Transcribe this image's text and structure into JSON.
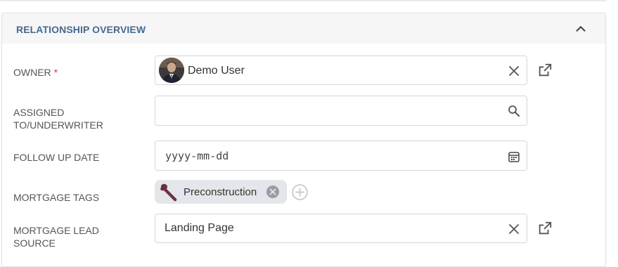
{
  "panel": {
    "title": "RELATIONSHIP OVERVIEW",
    "collapse_icon": "chevron-up-icon"
  },
  "fields": {
    "owner": {
      "label": "OWNER",
      "required_mark": "*",
      "value": "Demo User",
      "clear_icon": "close-icon",
      "link_icon": "open-in-new-icon"
    },
    "assigned_to": {
      "label_line1": "ASSIGNED",
      "label_line2": "TO/UNDERWRITER",
      "value": "",
      "search_icon": "search-icon"
    },
    "follow_up_date": {
      "label": "FOLLOW UP DATE",
      "placeholder": "yyyy-mm-dd",
      "calendar_icon": "calendar-icon"
    },
    "mortgage_tags": {
      "label": "MORTGAGE TAGS",
      "tags": [
        {
          "label": "Preconstruction",
          "icon": "wrench-icon",
          "icon_color": "#6b2f45"
        }
      ],
      "add_icon": "add-circle-icon"
    },
    "mortgage_lead_source": {
      "label_line1": "MORTGAGE LEAD",
      "label_line2": "SOURCE",
      "value": "Landing Page",
      "clear_icon": "close-icon",
      "link_icon": "open-in-new-icon"
    }
  },
  "colors": {
    "title": "#456a8c",
    "required": "#d0393b",
    "chip_bg": "#e3e6ea"
  }
}
